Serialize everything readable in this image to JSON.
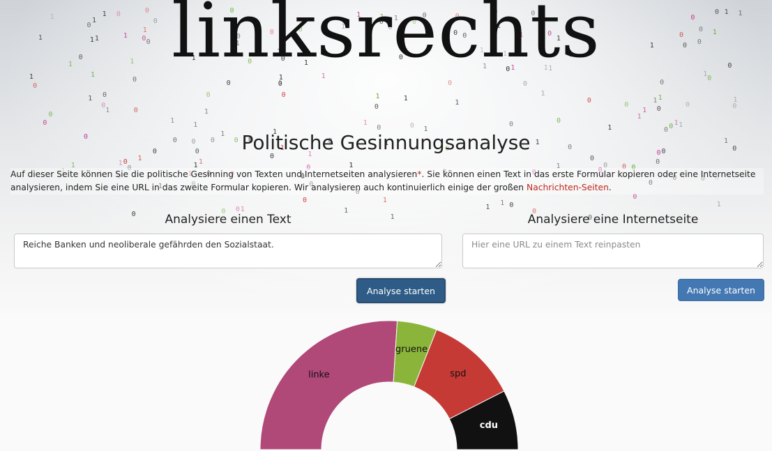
{
  "site": {
    "logo": "linksrechts",
    "subtitle": "Politische Gesinnungsanalyse"
  },
  "intro": {
    "part1": "Auf dieser Seite können Sie die politische Gesinning von Texten und Internetseiten analysieren",
    "asterisk": "*",
    "part2": ". Sie können einen Text in das erste Formular kopieren oder eine Internetseite analysieren, indem Sie eine URL in das zweite Formular kopieren. Wir analysieren auch kontinuierlich einige der großen ",
    "link": "Nachrichten-Seiten",
    "part3": "."
  },
  "text_form": {
    "heading": "Analysiere einen Text",
    "value": "Reiche Banken und neoliberale gefährden den Sozialstaat.",
    "button": "Analyse starten"
  },
  "url_form": {
    "heading": "Analysiere eine Internetseite",
    "placeholder": "Hier eine URL zu einem Text reinpasten",
    "button": "Analyse starten"
  },
  "colors": {
    "linke": "#b04878",
    "gruene": "#8bb53a",
    "spd": "#c63a36",
    "cdu": "#111111",
    "accent_red": "#c0271e",
    "button": "#4378b2"
  },
  "chart_data": {
    "type": "pie",
    "subtype": "semi-donut",
    "categories": [
      "linke",
      "gruene",
      "spd",
      "cdu"
    ],
    "values": [
      0.52,
      0.1,
      0.23,
      0.15
    ]
  }
}
